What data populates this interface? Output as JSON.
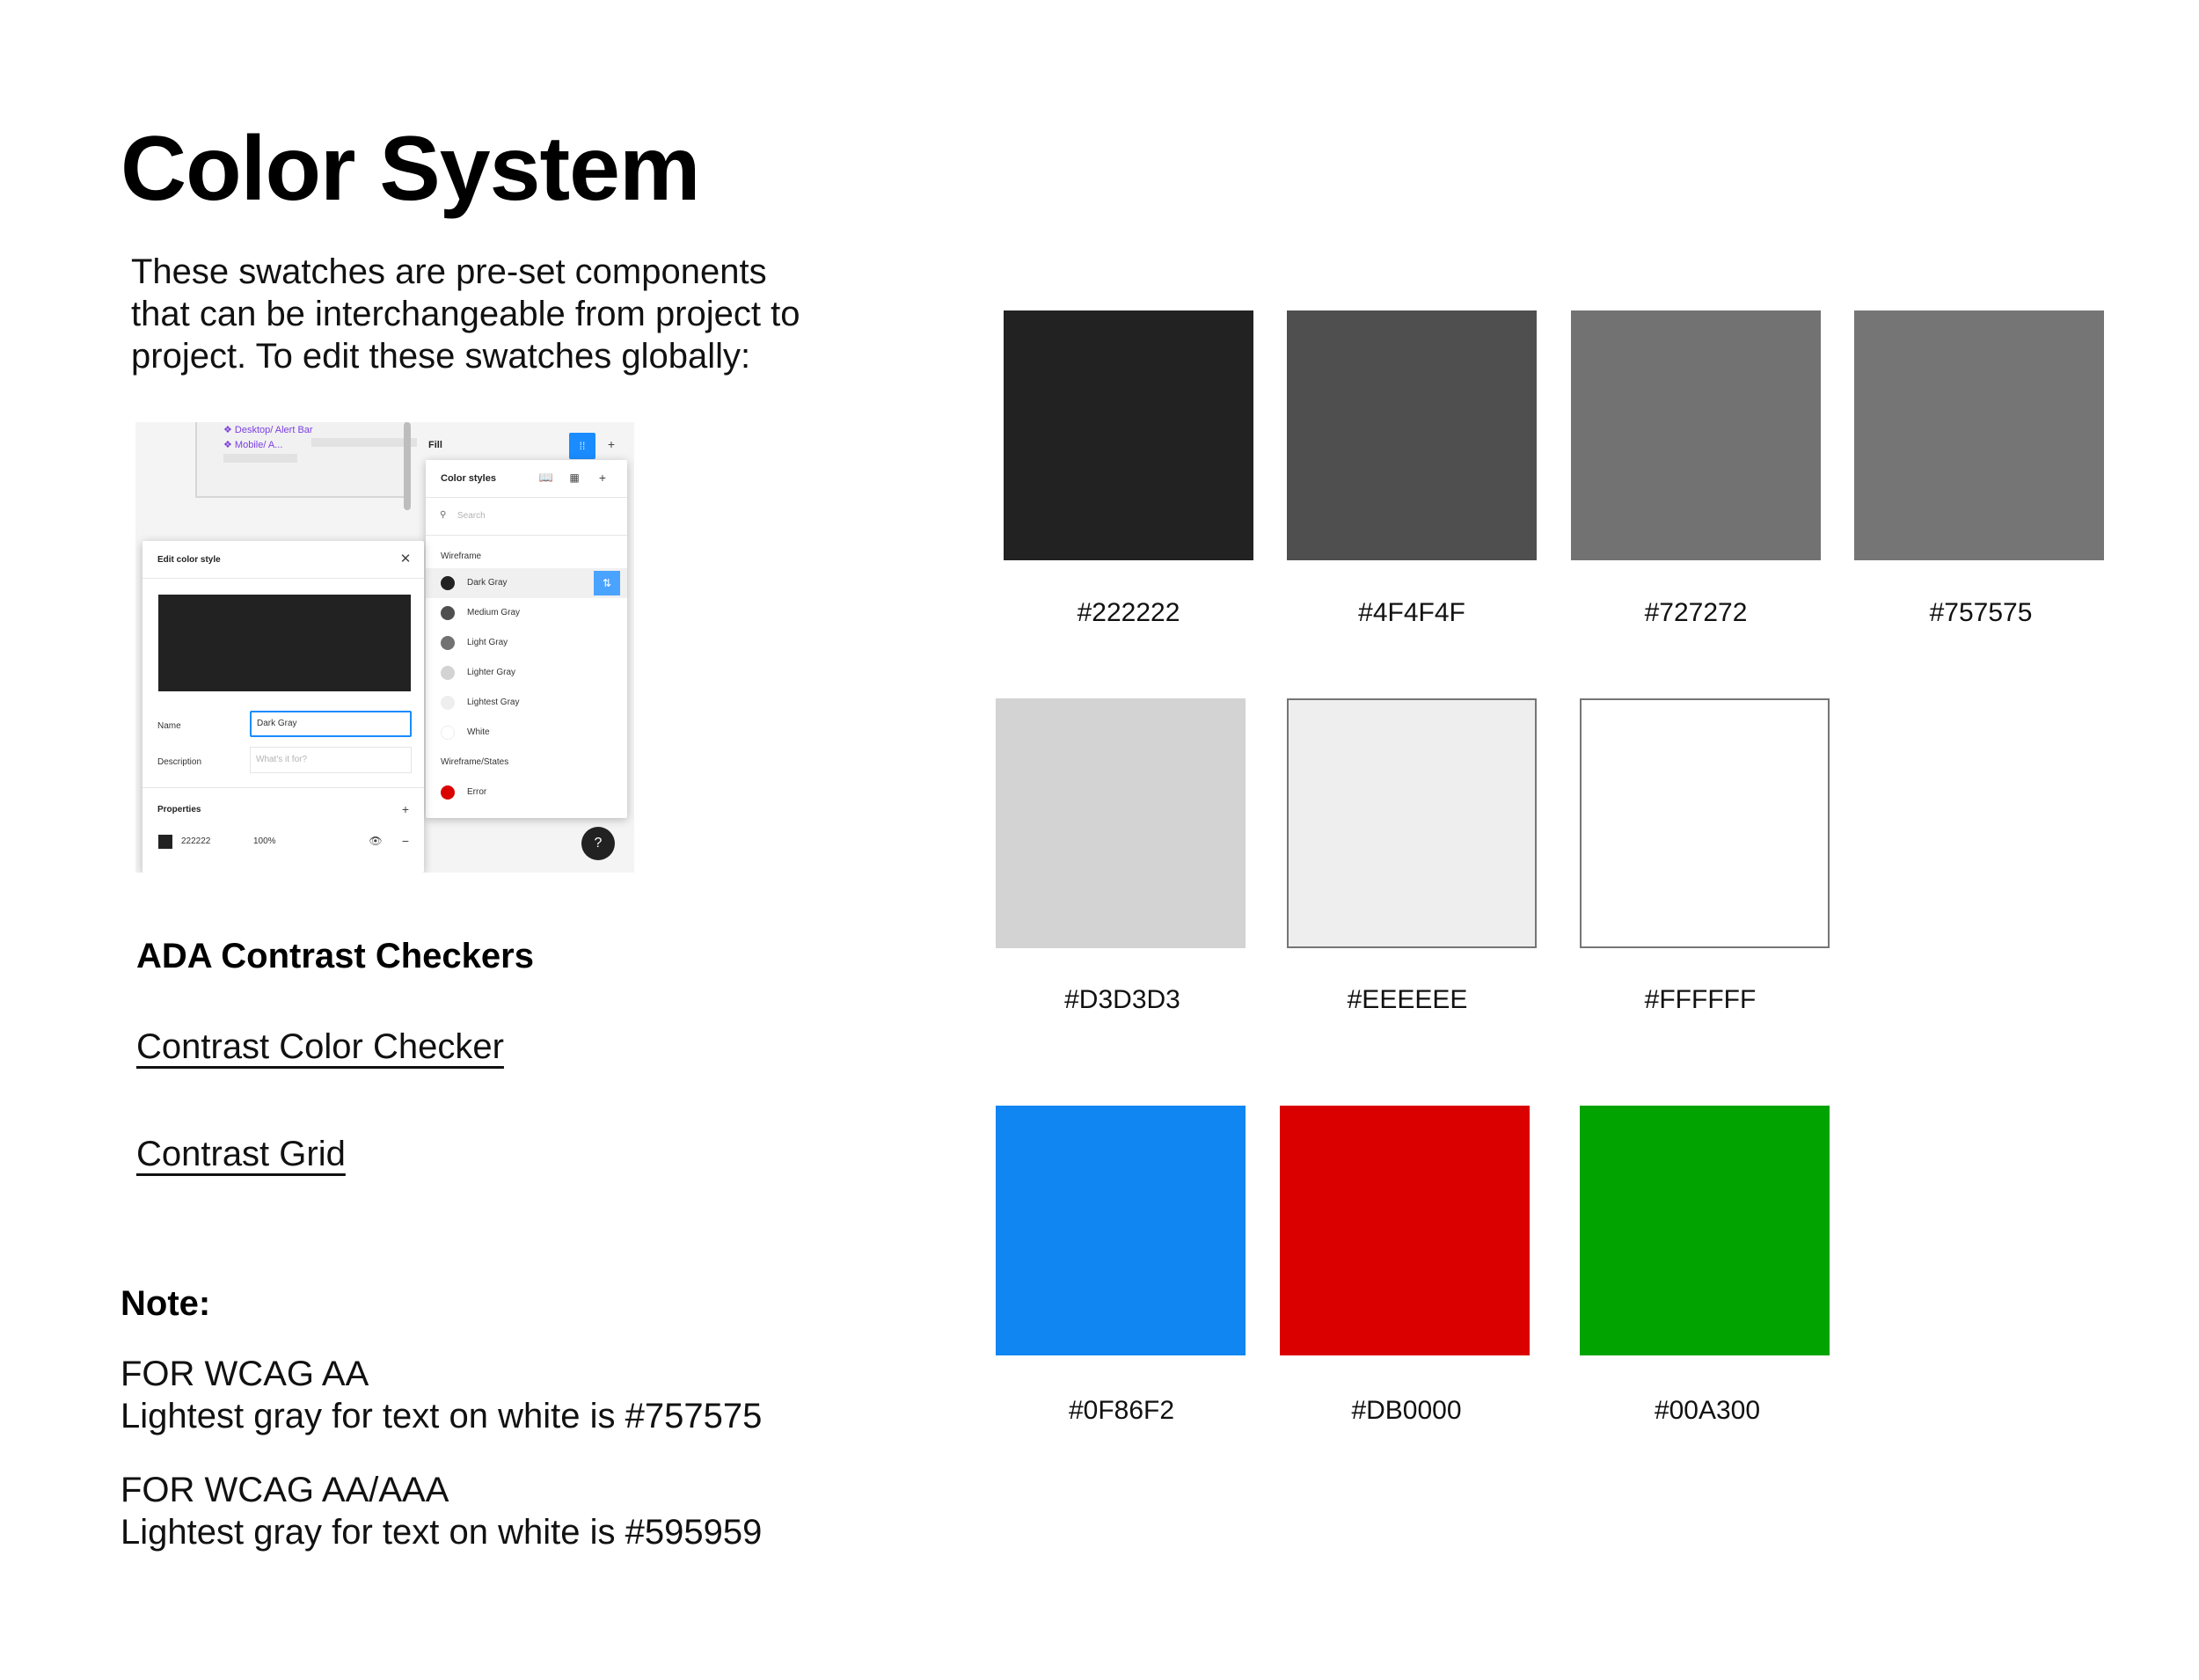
{
  "title": "Color System",
  "intro": {
    "line1": "These swatches are pre-set components",
    "line2": "that can be interchangeable from project to",
    "line3": "project. To edit these swatches globally:"
  },
  "figma": {
    "layers": {
      "desktop": "❖ Desktop/ Alert Bar",
      "mobile": "❖ Mobile/ A..."
    },
    "fill_label": "Fill",
    "color_styles": {
      "title": "Color styles",
      "search_placeholder": "Search",
      "group1": "Wireframe",
      "items": [
        {
          "label": "Dark Gray",
          "color": "#222222"
        },
        {
          "label": "Medium Gray",
          "color": "#4F4F4F"
        },
        {
          "label": "Light Gray",
          "color": "#727272"
        },
        {
          "label": "Lighter Gray",
          "color": "#D3D3D3"
        },
        {
          "label": "Lightest Gray",
          "color": "#EEEEEE"
        },
        {
          "label": "White",
          "color": "#FFFFFF"
        }
      ],
      "group2": "Wireframe/States",
      "error": {
        "label": "Error",
        "color": "#DB0000"
      }
    },
    "edit": {
      "title": "Edit color style",
      "preview_color": "#222222",
      "name_label": "Name",
      "name_value": "Dark Gray",
      "desc_label": "Description",
      "desc_placeholder": "What's it for?",
      "properties_label": "Properties",
      "prop_hex": "222222",
      "prop_opacity": "100%"
    },
    "help": "?"
  },
  "ada": {
    "heading": "ADA Contrast Checkers",
    "link1": "Contrast Color Checker",
    "link2": "Contrast Grid"
  },
  "note": {
    "heading": "Note:",
    "aa_title": "FOR WCAG AA",
    "aa_text": "Lightest gray for text on white is #757575",
    "aaa_title": "FOR WCAG AA/AAA",
    "aaa_text": "Lightest gray for text on white is #595959"
  },
  "swatches": [
    {
      "color": "#222222",
      "label": "#222222"
    },
    {
      "color": "#4F4F4F",
      "label": "#4F4F4F"
    },
    {
      "color": "#727272",
      "label": "#727272"
    },
    {
      "color": "#757575",
      "label": "#757575"
    },
    {
      "color": "#D3D3D3",
      "label": "#D3D3D3"
    },
    {
      "color": "#EEEEEE",
      "label": "#EEEEEE"
    },
    {
      "color": "#FFFFFF",
      "label": "#FFFFFF"
    },
    {
      "color": "#0F86F2",
      "label": "#0F86F2"
    },
    {
      "color": "#DB0000",
      "label": "#DB0000"
    },
    {
      "color": "#00A300",
      "label": "#00A300"
    }
  ]
}
